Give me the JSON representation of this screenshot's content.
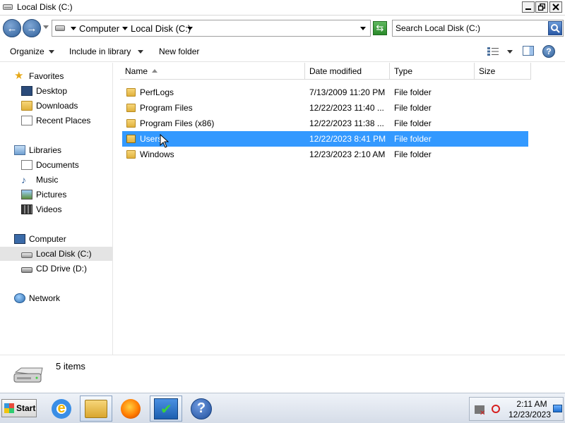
{
  "window": {
    "title": "Local Disk (C:)"
  },
  "address": {
    "crumbs": [
      "Computer",
      "Local Disk (C:)"
    ],
    "search_placeholder": "Search Local Disk (C:)"
  },
  "toolbar": {
    "organize": "Organize",
    "include_in_library": "Include in library",
    "new_folder": "New folder"
  },
  "nav": {
    "favorites": "Favorites",
    "desktop": "Desktop",
    "downloads": "Downloads",
    "recent_places": "Recent Places",
    "libraries": "Libraries",
    "documents": "Documents",
    "music": "Music",
    "pictures": "Pictures",
    "videos": "Videos",
    "computer": "Computer",
    "local_disk": "Local Disk (C:)",
    "cd_drive": "CD Drive (D:)",
    "network": "Network"
  },
  "columns": {
    "name": "Name",
    "date_modified": "Date modified",
    "type": "Type",
    "size": "Size"
  },
  "files": [
    {
      "name": "PerfLogs",
      "date": "7/13/2009 11:20 PM",
      "type": "File folder"
    },
    {
      "name": "Program Files",
      "date": "12/22/2023 11:40 ...",
      "type": "File folder"
    },
    {
      "name": "Program Files (x86)",
      "date": "12/22/2023 11:38 ...",
      "type": "File folder"
    },
    {
      "name": "Users",
      "date": "12/22/2023 8:41 PM",
      "type": "File folder"
    },
    {
      "name": "Windows",
      "date": "12/23/2023 2:10 AM",
      "type": "File folder"
    }
  ],
  "selected_file": "Users",
  "details": {
    "count": "5 items"
  },
  "taskbar": {
    "start": "Start",
    "time": "2:11 AM",
    "date": "12/23/2023"
  },
  "colors": {
    "selection": "#3399ff",
    "accent": "#2f5f99"
  }
}
